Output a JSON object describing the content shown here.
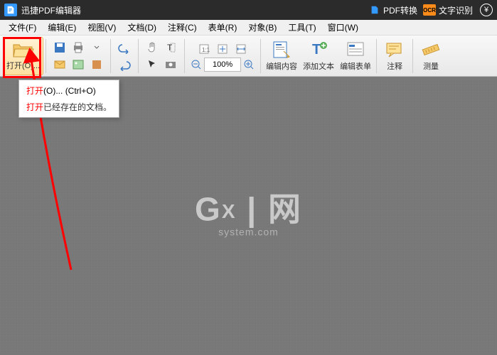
{
  "titlebar": {
    "app_name": "迅捷PDF编辑器",
    "pdf_convert": "PDF转换",
    "ocr_label": "文字识别",
    "ocr_badge": "OCR",
    "yen": "¥"
  },
  "menu": {
    "file": "文件(F)",
    "edit": "编辑(E)",
    "view": "视图(V)",
    "doc": "文档(D)",
    "comment": "注释(C)",
    "form": "表单(R)",
    "object": "对象(B)",
    "tool": "工具(T)",
    "window": "窗口(W)"
  },
  "toolbar": {
    "open_label": "打开(O)...",
    "zoom_value": "100%",
    "edit_content": "编辑内容",
    "add_text": "添加文本",
    "edit_form": "编辑表单",
    "annotate": "注释",
    "measure": "测量"
  },
  "tooltip": {
    "title_pre": "打开",
    "title_key": "(O)...",
    "shortcut": "(Ctrl+O)",
    "desc_pre": "打开",
    "desc": "已经存在的文档。"
  },
  "watermark": {
    "main": "G   | 网",
    "x": "X",
    "sub": "system.com"
  }
}
